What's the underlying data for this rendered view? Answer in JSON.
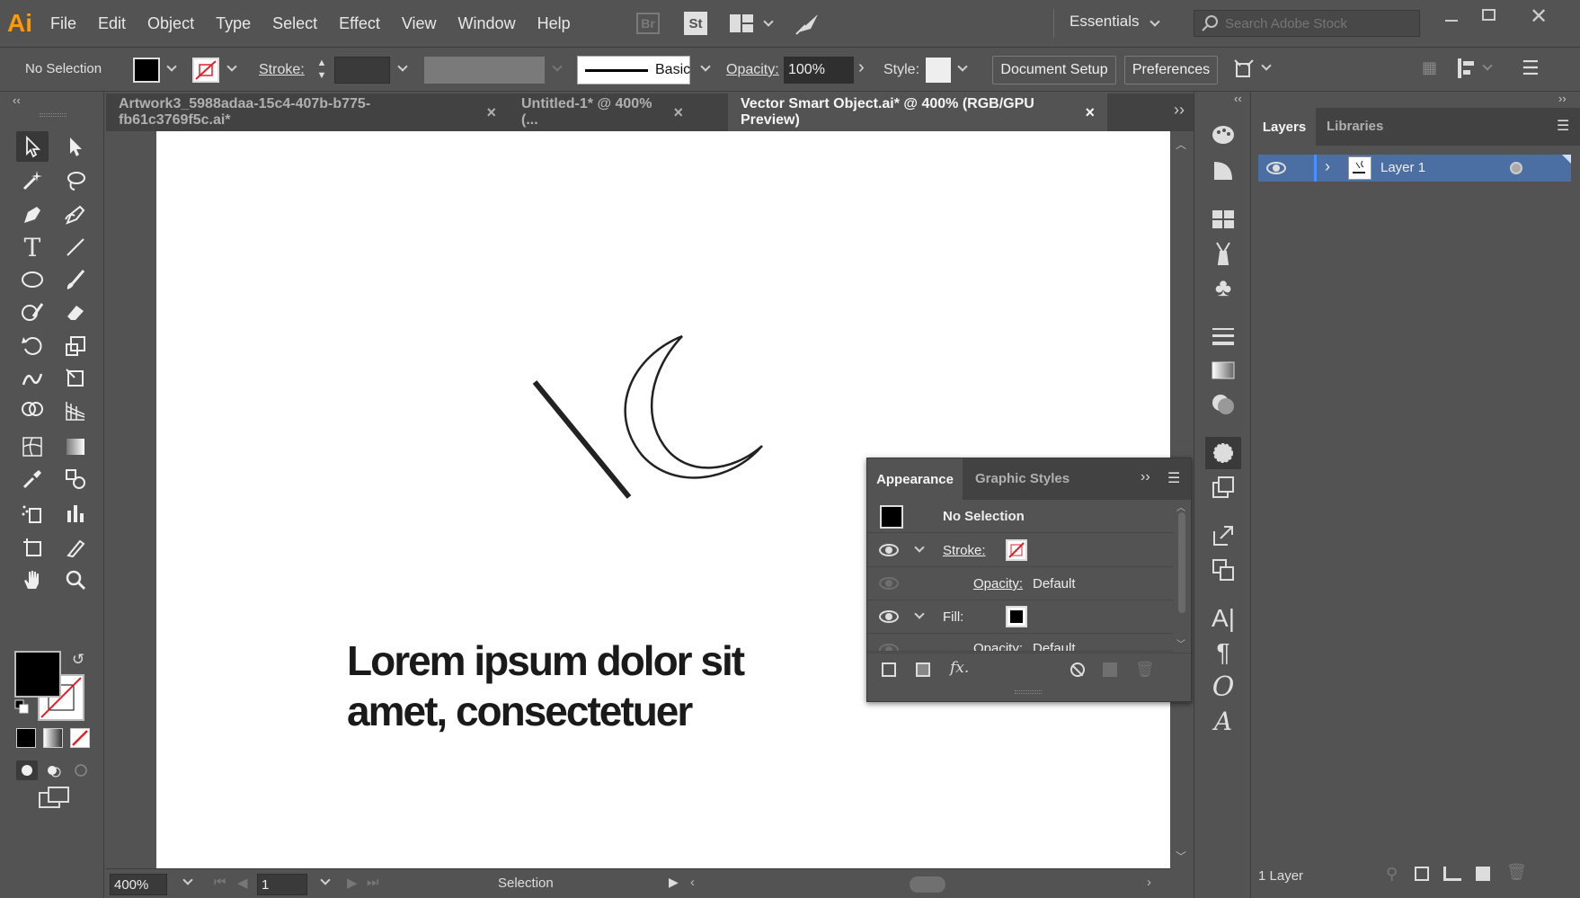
{
  "menu": {
    "logo": "Ai",
    "items": [
      "File",
      "Edit",
      "Object",
      "Type",
      "Select",
      "Effect",
      "View",
      "Window",
      "Help"
    ],
    "bridge": "Br",
    "stock": "St",
    "workspace": "Essentials",
    "search_placeholder": "Search Adobe Stock"
  },
  "control": {
    "selection": "No Selection",
    "stroke_label": "Stroke:",
    "brush_label": "Basic",
    "opacity_label": "Opacity:",
    "opacity_value": "100%",
    "style_label": "Style:",
    "document_setup": "Document Setup",
    "preferences": "Preferences"
  },
  "tabs": [
    {
      "label": "Artwork3_5988adaa-15c4-407b-b775-fb61c3769f5c.ai*",
      "close": "×"
    },
    {
      "label": "Untitled-1* @ 400% (...",
      "close": "×"
    },
    {
      "label": "Vector Smart Object.ai* @ 400% (RGB/GPU Preview)",
      "close": "×"
    }
  ],
  "canvas": {
    "text_line1": "Lorem ipsum dolor sit",
    "text_line2": "amet, consectetuer"
  },
  "status": {
    "zoom": "400%",
    "artboard": "1",
    "tool": "Selection"
  },
  "appearance": {
    "tab1": "Appearance",
    "tab2": "Graphic Styles",
    "title": "No Selection",
    "stroke_label": "Stroke:",
    "opacity_label": "Opacity:",
    "opacity_value": "Default",
    "fill_label": "Fill:",
    "opacity2_label": "Opacity:",
    "opacity2_value": "Default",
    "fx": "fx."
  },
  "layers": {
    "tab1": "Layers",
    "tab2": "Libraries",
    "layer_name": "Layer 1",
    "count": "1 Layer"
  },
  "colors": {
    "accent": "#ff9a00",
    "panel": "#535353",
    "dark": "#424242",
    "selection_row": "#4b6ea3"
  }
}
